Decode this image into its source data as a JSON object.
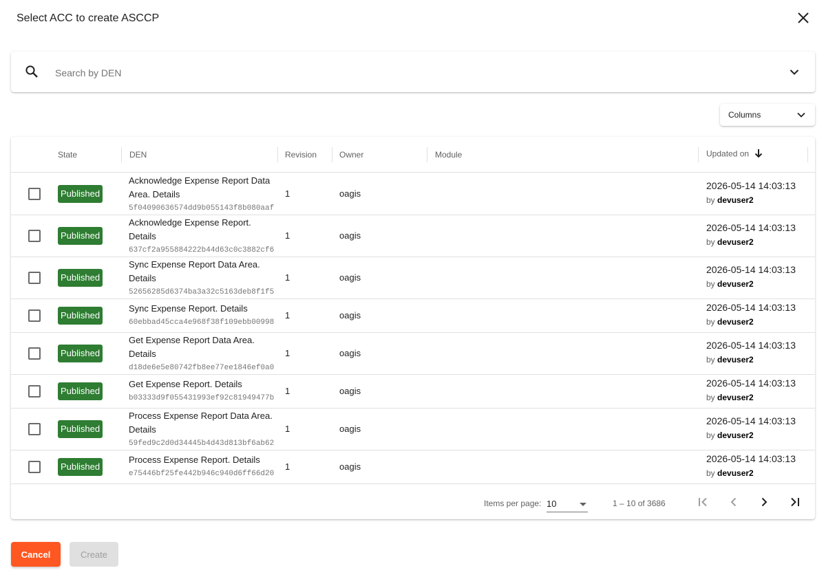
{
  "dialog": {
    "title": "Select ACC to create ASCCP"
  },
  "search": {
    "placeholder": "Search by DEN",
    "value": ""
  },
  "columns_button": {
    "label": "Columns"
  },
  "table": {
    "headers": {
      "state": "State",
      "den": "DEN",
      "revision": "Revision",
      "owner": "Owner",
      "module": "Module",
      "updated_on": "Updated on"
    },
    "rows": [
      {
        "state": "Published",
        "den": "Acknowledge Expense Report Data Area. Details",
        "guid": "5f04090636574dd9b055143f8b080aaf",
        "revision": "1",
        "owner": "oagis",
        "module": "",
        "updated": "2026-05-14 14:03:13",
        "by_prefix": "by",
        "updated_by": "devuser2"
      },
      {
        "state": "Published",
        "den": "Acknowledge Expense Report. Details",
        "guid": "637cf2a955884222b44d63c0c3882cf6",
        "revision": "1",
        "owner": "oagis",
        "module": "",
        "updated": "2026-05-14 14:03:13",
        "by_prefix": "by",
        "updated_by": "devuser2"
      },
      {
        "state": "Published",
        "den": "Sync Expense Report Data Area. Details",
        "guid": "52656285d6374ba3a32c5163deb8f1f5",
        "revision": "1",
        "owner": "oagis",
        "module": "",
        "updated": "2026-05-14 14:03:13",
        "by_prefix": "by",
        "updated_by": "devuser2"
      },
      {
        "state": "Published",
        "den": "Sync Expense Report. Details",
        "guid": "60ebbad45cca4e968f38f109ebb00998",
        "revision": "1",
        "owner": "oagis",
        "module": "",
        "updated": "2026-05-14 14:03:13",
        "by_prefix": "by",
        "updated_by": "devuser2"
      },
      {
        "state": "Published",
        "den": "Get Expense Report Data Area. Details",
        "guid": "d18de6e5e80742fb8ee77ee1846ef0a0",
        "revision": "1",
        "owner": "oagis",
        "module": "",
        "updated": "2026-05-14 14:03:13",
        "by_prefix": "by",
        "updated_by": "devuser2"
      },
      {
        "state": "Published",
        "den": "Get Expense Report. Details",
        "guid": "b03333d9f055431993ef92c81949477b",
        "revision": "1",
        "owner": "oagis",
        "module": "",
        "updated": "2026-05-14 14:03:13",
        "by_prefix": "by",
        "updated_by": "devuser2"
      },
      {
        "state": "Published",
        "den": "Process Expense Report Data Area. Details",
        "guid": "59fed9c2d0d34445b4d43d813bf6ab62",
        "revision": "1",
        "owner": "oagis",
        "module": "",
        "updated": "2026-05-14 14:03:13",
        "by_prefix": "by",
        "updated_by": "devuser2"
      },
      {
        "state": "Published",
        "den": "Process Expense Report. Details",
        "guid": "e75446bf25fe442b946c940d6ff66d20",
        "revision": "1",
        "owner": "oagis",
        "module": "",
        "updated": "2026-05-14 14:03:13",
        "by_prefix": "by",
        "updated_by": "devuser2"
      }
    ]
  },
  "paginator": {
    "items_per_page_label": "Items per page:",
    "page_size": "10",
    "range_label": "1 – 10 of 3686"
  },
  "actions": {
    "cancel_label": "Cancel",
    "create_label": "Create"
  },
  "colors": {
    "published_badge": "#2e7d32",
    "cancel_button": "#ff5722",
    "create_disabled": "#e0e0e0"
  },
  "icons": {
    "close": "close-icon",
    "search": "search-icon",
    "expand": "chevron-down-icon",
    "sort": "arrow-down-icon",
    "first_page": "first-page-icon",
    "prev_page": "chevron-left-icon",
    "next_page": "chevron-right-icon",
    "last_page": "last-page-icon"
  }
}
